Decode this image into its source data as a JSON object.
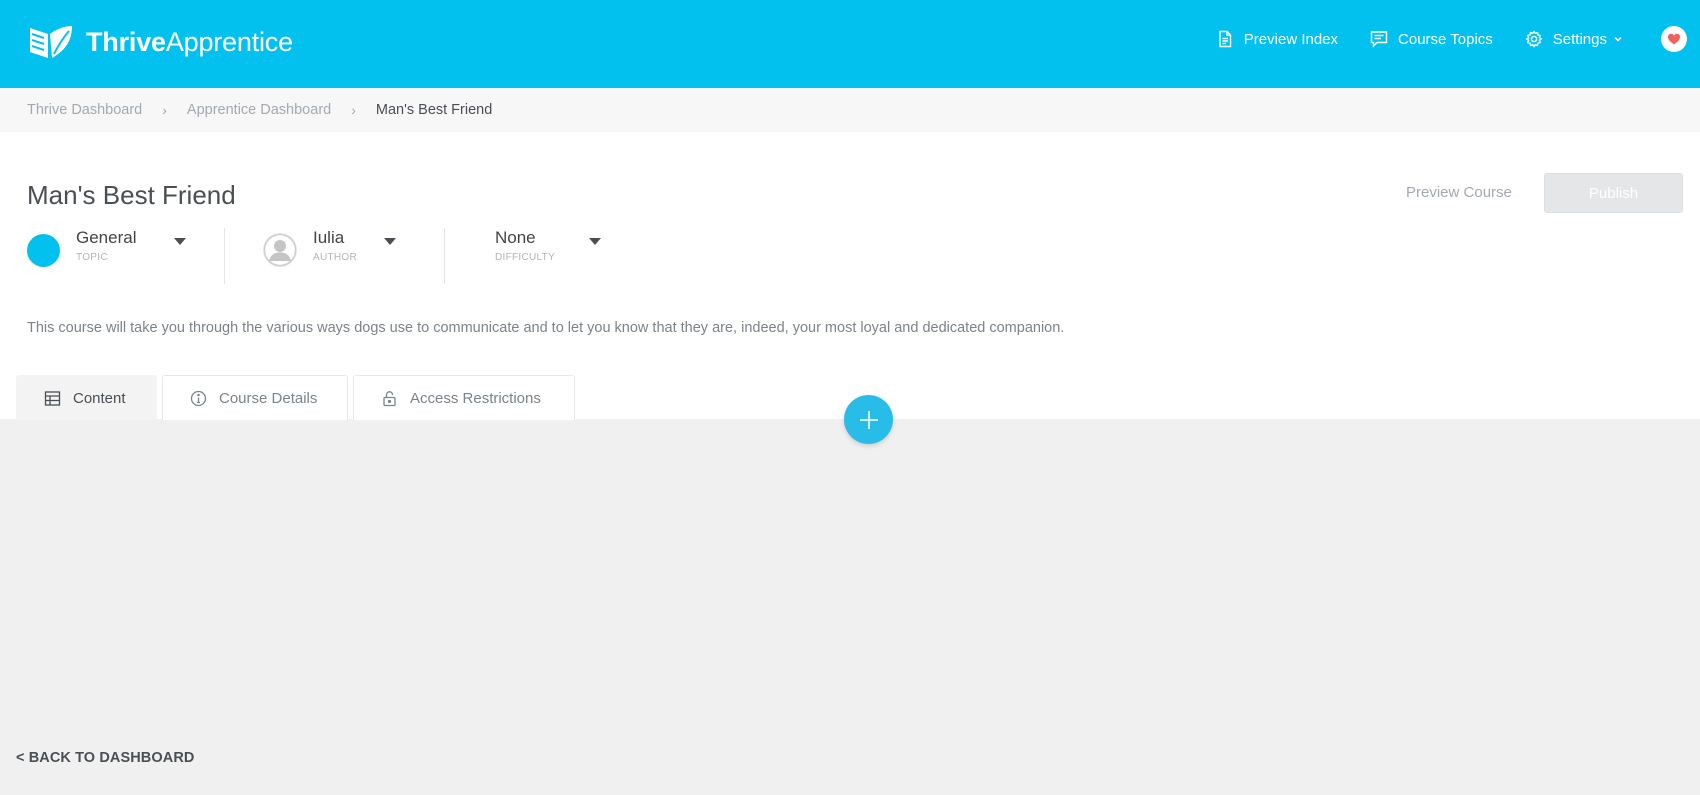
{
  "header": {
    "brand_bold": "Thrive",
    "brand_light": "Apprentice",
    "logo_icon": "open-book-leaf-icon",
    "nav": {
      "preview_index": "Preview Index",
      "course_topics": "Course Topics",
      "settings": "Settings"
    },
    "accent_color": "#02c1ef",
    "heart_color": "#f0625b"
  },
  "breadcrumb": {
    "items": [
      "Thrive Dashboard",
      "Apprentice Dashboard",
      "Man's Best Friend"
    ],
    "separator": "›"
  },
  "course": {
    "title": "Man's Best Friend",
    "preview_label": "Preview Course",
    "publish_label": "Publish",
    "topic": {
      "value": "General",
      "label": "TOPIC",
      "color": "#02c1ef"
    },
    "author": {
      "value": "Iulia",
      "label": "AUTHOR"
    },
    "difficulty": {
      "value": "None",
      "label": "DIFFICULTY"
    },
    "description": "This course will take you through the various ways dogs use to communicate and to let you know that they are, indeed, your most loyal and dedicated companion."
  },
  "tabs": [
    {
      "label": "Content",
      "icon": "table-icon",
      "active": true
    },
    {
      "label": "Course Details",
      "icon": "info-icon",
      "active": false
    },
    {
      "label": "Access Restrictions",
      "icon": "lock-icon",
      "active": false
    }
  ],
  "footer": {
    "back_label": "< BACK TO DASHBOARD"
  }
}
